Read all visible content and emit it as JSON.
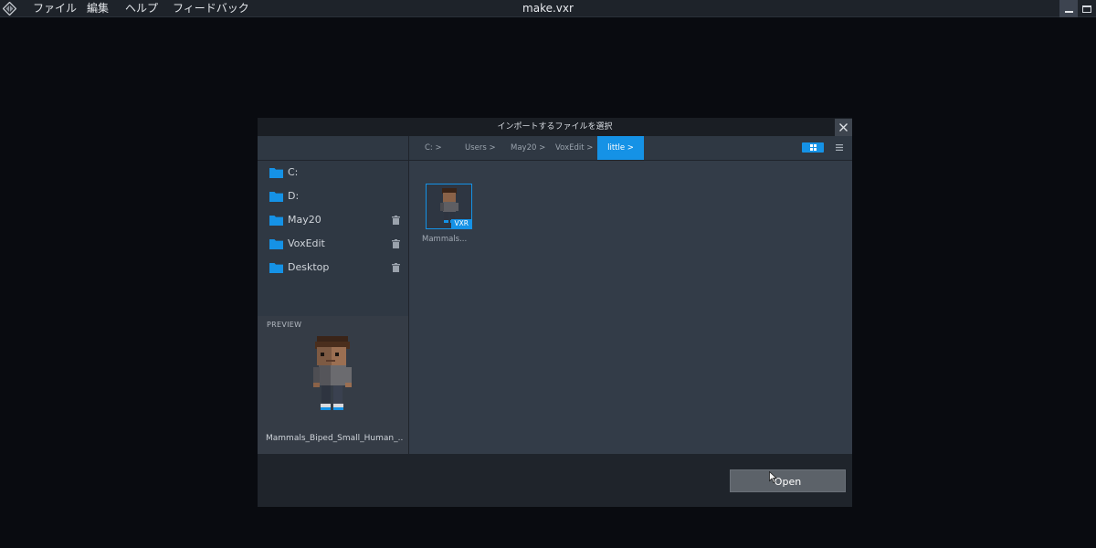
{
  "window": {
    "title": "make.vxr",
    "logo_icon": "voxedit-logo-icon"
  },
  "menu": {
    "items": [
      "ファイル",
      "編集",
      "ヘルプ",
      "フィードバック"
    ]
  },
  "dialog": {
    "title": "インポートするファイルを選択",
    "breadcrumbs": [
      "C: >",
      "Users >",
      "May20 >",
      "VoxEdit >",
      "little >"
    ],
    "active_breadcrumb": "little >",
    "view_mode": "grid",
    "sidebar": {
      "items": [
        {
          "label": "C:",
          "icon": "folder-icon",
          "removable": false
        },
        {
          "label": "D:",
          "icon": "folder-icon",
          "removable": false
        },
        {
          "label": "May20",
          "icon": "folder-icon",
          "removable": true
        },
        {
          "label": "VoxEdit",
          "icon": "folder-icon",
          "removable": true
        },
        {
          "label": "Desktop",
          "icon": "folder-icon",
          "removable": true
        }
      ]
    },
    "preview": {
      "label": "PREVIEW",
      "file_name": "Mammals_Biped_Small_Human_..."
    },
    "files": [
      {
        "name": "Mammals...",
        "badge": "VXR",
        "selected": true
      }
    ],
    "open_label": "Open"
  },
  "colors": {
    "accent": "#1592e6",
    "panel": "#2f3843",
    "file_area": "#333c48",
    "background": "#090b10"
  }
}
